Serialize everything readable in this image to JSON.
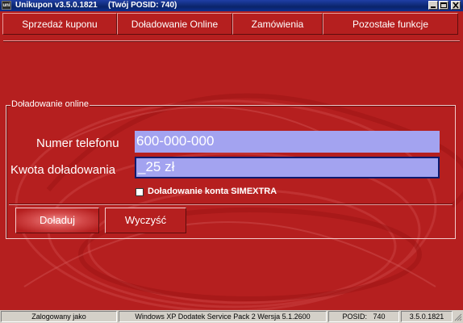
{
  "window": {
    "app_icon_text": "uni",
    "title": "Unikupon v3.5.0.1821",
    "subtitle": "(Twój POSID: 740)"
  },
  "menu": {
    "tabs": [
      "Sprzedaż kuponu",
      "Doładowanie Online",
      "Zamówienia",
      "Pozostałe funkcje"
    ]
  },
  "form": {
    "legend": "Doładowanie online",
    "phone_label": "Numer telefonu",
    "phone_value": "600-000-000",
    "amount_label": "Kwota doładowania",
    "amount_value": "_25 zł",
    "simextra_label": "Doładowanie konta SIMEXTRA",
    "simextra_checked": false
  },
  "buttons": {
    "submit": "Doładuj",
    "clear": "Wyczyść"
  },
  "statusbar": {
    "user": "Zalogowany jako",
    "os": "Windows XP Dodatek Service Pack 2 Wersja 5.1.2600",
    "posid_label": "POSID:",
    "posid_value": "740",
    "version": "3.5.0.1821"
  },
  "colors": {
    "background": "#b51f1f",
    "field": "#a3a3f0",
    "titlebar": "#0a246a"
  }
}
